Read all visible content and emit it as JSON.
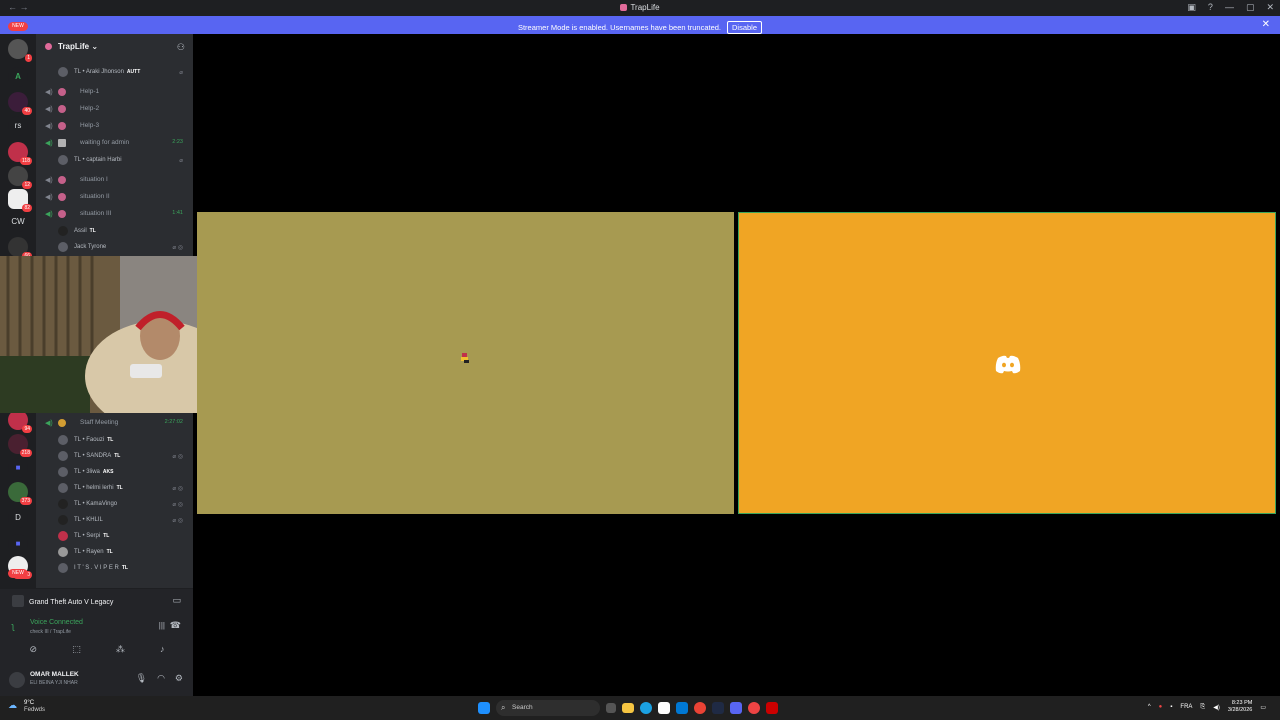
{
  "window": {
    "title": "TrapLife",
    "nav": "←  →"
  },
  "banner": {
    "message": "Streamer Mode is enabled. Usernames have been truncated.",
    "button": "Disable",
    "close": "✕"
  },
  "guilds": [
    {
      "label": "",
      "badge": "1"
    },
    {
      "label": "A",
      "badge": ""
    },
    {
      "label": "",
      "badge": "40"
    },
    {
      "label": "rs",
      "badge": ""
    },
    {
      "label": "",
      "badge": "118"
    },
    {
      "label": "",
      "badge": "12"
    },
    {
      "label": "",
      "badge": "82"
    },
    {
      "label": "CW",
      "badge": ""
    },
    {
      "label": "",
      "badge": "66"
    }
  ],
  "guilds_lower": [
    {
      "label": "",
      "badge": "94"
    },
    {
      "label": "",
      "badge": "218"
    },
    {
      "label": "",
      "badge": ""
    },
    {
      "label": "",
      "badge": "373"
    },
    {
      "label": "D",
      "badge": ""
    },
    {
      "label": "",
      "badge": ""
    },
    {
      "label": "",
      "badge": "51,000"
    }
  ],
  "new_label": "NEW",
  "server": {
    "name": "TrapLife ⌄"
  },
  "channels": {
    "top_user": {
      "prefix": "TL",
      "name": "Araki Jhonson",
      "tag": "AUTT"
    },
    "help1": "Help-1",
    "help2": "Help-2",
    "help3": "Help-3",
    "waiting": "waiting for admin",
    "waiting_time": "2:23",
    "waiting_user": {
      "prefix": "TL",
      "name": "captain Harbi"
    },
    "sit1": "situation I",
    "sit2": "situation II",
    "sit3": "situation III",
    "sit3_time": "1:41",
    "sit3_u1": {
      "name": "Assil",
      "tag": "TL"
    },
    "sit3_u2": {
      "name": "Jack Tyrone"
    },
    "staff": "Staff Meeting",
    "staff_time": "2:27:02",
    "staff_users": [
      {
        "prefix": "TL",
        "name": "Faouzi",
        "tag": "TL"
      },
      {
        "prefix": "TL",
        "name": "SANDRA",
        "tag": "TL"
      },
      {
        "prefix": "TL",
        "name": "3liwa",
        "tag": "AKS"
      },
      {
        "prefix": "TL",
        "name": "helmi lerhi",
        "tag": "TL"
      },
      {
        "prefix": "TL",
        "name": "KamaVingo",
        "tag": ""
      },
      {
        "prefix": "TL",
        "name": "KHLIL",
        "tag": ""
      },
      {
        "prefix": "TL",
        "name": "Serpi",
        "tag": "TL"
      },
      {
        "prefix": "TL",
        "name": "Rayen",
        "tag": "TL"
      },
      {
        "prefix": "",
        "name": "I T ' S . V I P E R",
        "tag": "TL"
      }
    ]
  },
  "panel": {
    "game": "Grand Theft Auto V Legacy",
    "voice_status": "Voice Connected",
    "voice_channel": "check III / TrapLife"
  },
  "user": {
    "name": "OMAR MALLEK",
    "status": "ELI BEINA YJI NHAR"
  },
  "taskbar": {
    "temp": "9°C",
    "weather": "Fedwds",
    "search": "Search",
    "lang": "FRA",
    "time": "8:23 PM",
    "date": "3/28/2026"
  },
  "colors": {
    "accent": "#5865f2",
    "tile_left": "#a79a51",
    "tile_right": "#f0a524",
    "speaking": "#3ba55c"
  }
}
